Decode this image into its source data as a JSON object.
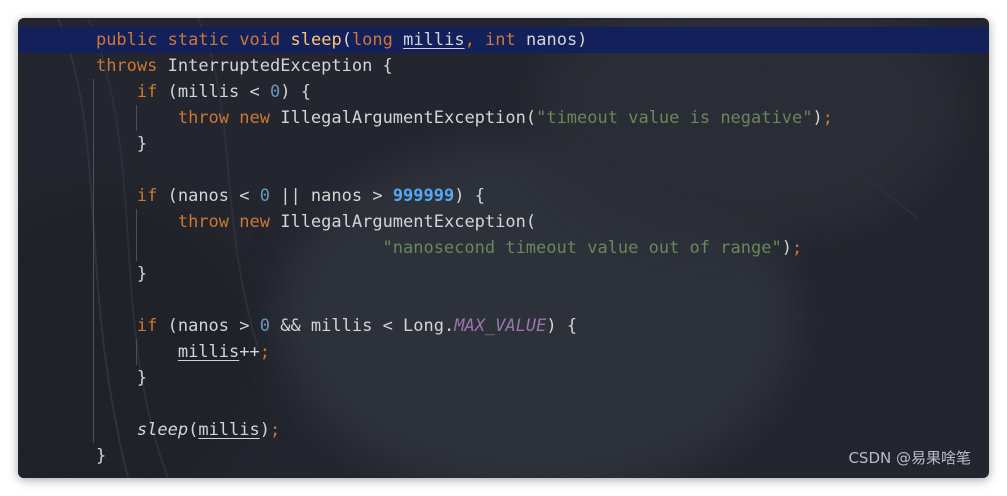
{
  "code_lines": [
    {
      "tokens": [
        [
          "    ",
          "plain"
        ],
        [
          "public",
          "kw"
        ],
        [
          " ",
          "plain"
        ],
        [
          "static",
          "kw"
        ],
        [
          " ",
          "plain"
        ],
        [
          "void",
          "kw"
        ],
        [
          " ",
          "plain"
        ],
        [
          "sleep",
          "fn"
        ],
        [
          "(",
          "plain"
        ],
        [
          "long",
          "kw"
        ],
        [
          " ",
          "plain"
        ],
        [
          "millis",
          "ul"
        ],
        [
          ", ",
          "kw"
        ],
        [
          "int",
          "kw"
        ],
        [
          " nanos)",
          "plain"
        ]
      ],
      "guides": [],
      "highlight": true
    },
    {
      "tokens": [
        [
          "    ",
          "plain"
        ],
        [
          "throws",
          "kw"
        ],
        [
          " InterruptedException {",
          "plain"
        ]
      ],
      "guides": []
    },
    {
      "tokens": [
        [
          "        ",
          "plain"
        ],
        [
          "if",
          "kw"
        ],
        [
          " (millis < ",
          "plain"
        ],
        [
          "0",
          "num"
        ],
        [
          ") {",
          "plain"
        ]
      ],
      "guides": [
        1
      ]
    },
    {
      "tokens": [
        [
          "            ",
          "plain"
        ],
        [
          "throw",
          "kw"
        ],
        [
          " ",
          "plain"
        ],
        [
          "new",
          "kw"
        ],
        [
          " IllegalArgumentException(",
          "plain"
        ],
        [
          "\"timeout value is negative\"",
          "str"
        ],
        [
          ")",
          "plain"
        ],
        [
          ";",
          "kw"
        ]
      ],
      "guides": [
        1,
        2
      ]
    },
    {
      "tokens": [
        [
          "        }",
          "plain"
        ]
      ],
      "guides": [
        1
      ]
    },
    {
      "tokens": [
        [
          "",
          "plain"
        ]
      ],
      "guides": [
        1
      ]
    },
    {
      "tokens": [
        [
          "        ",
          "plain"
        ],
        [
          "if",
          "kw"
        ],
        [
          " (nanos < ",
          "plain"
        ],
        [
          "0",
          "num"
        ],
        [
          " || nanos > ",
          "plain"
        ],
        [
          "999999",
          "num bold"
        ],
        [
          ") {",
          "plain"
        ]
      ],
      "guides": [
        1
      ]
    },
    {
      "tokens": [
        [
          "            ",
          "plain"
        ],
        [
          "throw",
          "kw"
        ],
        [
          " ",
          "plain"
        ],
        [
          "new",
          "kw"
        ],
        [
          " IllegalArgumentException(",
          "plain"
        ]
      ],
      "guides": [
        1,
        2
      ]
    },
    {
      "tokens": [
        [
          "                                ",
          "plain"
        ],
        [
          "\"nanosecond timeout value out of range\"",
          "str"
        ],
        [
          ")",
          "plain"
        ],
        [
          ";",
          "kw"
        ]
      ],
      "guides": [
        1,
        2
      ]
    },
    {
      "tokens": [
        [
          "        }",
          "plain"
        ]
      ],
      "guides": [
        1
      ]
    },
    {
      "tokens": [
        [
          "",
          "plain"
        ]
      ],
      "guides": [
        1
      ]
    },
    {
      "tokens": [
        [
          "        ",
          "plain"
        ],
        [
          "if",
          "kw"
        ],
        [
          " (nanos > ",
          "plain"
        ],
        [
          "0",
          "num"
        ],
        [
          " && millis < Long.",
          "plain"
        ],
        [
          "MAX_VALUE",
          "const"
        ],
        [
          ") {",
          "plain"
        ]
      ],
      "guides": [
        1
      ]
    },
    {
      "tokens": [
        [
          "            ",
          "plain"
        ],
        [
          "millis",
          "ul"
        ],
        [
          "++",
          "plain"
        ],
        [
          ";",
          "kw"
        ]
      ],
      "guides": [
        1,
        2
      ]
    },
    {
      "tokens": [
        [
          "        }",
          "plain"
        ]
      ],
      "guides": [
        1
      ]
    },
    {
      "tokens": [
        [
          "",
          "plain"
        ]
      ],
      "guides": [
        1
      ]
    },
    {
      "tokens": [
        [
          "        ",
          "plain"
        ],
        [
          "sleep",
          "it"
        ],
        [
          "(",
          "plain"
        ],
        [
          "millis",
          "ul"
        ],
        [
          ")",
          "plain"
        ],
        [
          ";",
          "kw"
        ]
      ],
      "guides": [
        1
      ]
    },
    {
      "tokens": [
        [
          "    }",
          "plain"
        ]
      ],
      "guides": []
    }
  ],
  "watermark": "CSDN @易果啥笔"
}
